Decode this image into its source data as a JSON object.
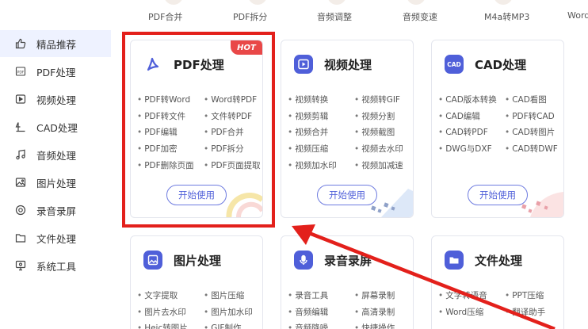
{
  "top_tools": [
    "PDF合并",
    "PDF拆分",
    "音频调整",
    "音频变速",
    "M4a转MP3",
    "Word"
  ],
  "sidebar": {
    "items": [
      {
        "label": "精品推荐",
        "icon": "thumbs-up-icon",
        "active": true
      },
      {
        "label": "PDF处理",
        "icon": "pdf-icon"
      },
      {
        "label": "视频处理",
        "icon": "video-play-icon"
      },
      {
        "label": "CAD处理",
        "icon": "cad-icon"
      },
      {
        "label": "音频处理",
        "icon": "music-note-icon"
      },
      {
        "label": "图片处理",
        "icon": "image-icon"
      },
      {
        "label": "录音录屏",
        "icon": "record-icon"
      },
      {
        "label": "文件处理",
        "icon": "folder-icon"
      },
      {
        "label": "系统工具",
        "icon": "system-tool-icon"
      }
    ]
  },
  "cards": [
    {
      "title": "PDF处理",
      "badge": "HOT",
      "icon": "pdf-icon",
      "features": [
        "PDF转Word",
        "Word转PDF",
        "PDF转文件",
        "文件转PDF",
        "PDF编辑",
        "PDF合并",
        "PDF加密",
        "PDF拆分",
        "PDF删除页面",
        "PDF页面提取"
      ],
      "button": "开始使用"
    },
    {
      "title": "视频处理",
      "icon": "video-play-icon",
      "features": [
        "视频转换",
        "视频转GIF",
        "视频剪辑",
        "视频分割",
        "视频合并",
        "视频截图",
        "视频压缩",
        "视频去水印",
        "视频加水印",
        "视频加减速"
      ],
      "button": "开始使用"
    },
    {
      "title": "CAD处理",
      "icon": "cad-icon",
      "features": [
        "CAD版本转换",
        "CAD看图",
        "CAD编辑",
        "PDF转CAD",
        "CAD转PDF",
        "CAD转图片",
        "DWG与DXF",
        "CAD转DWF"
      ],
      "button": "开始使用"
    },
    {
      "title": "图片处理",
      "icon": "image-icon",
      "features": [
        "文字提取",
        "图片压缩",
        "图片去水印",
        "图片加水印",
        "Heic转图片",
        "GIF制作"
      ]
    },
    {
      "title": "录音录屏",
      "icon": "microphone-icon",
      "features": [
        "录音工具",
        "屏幕录制",
        "音频编辑",
        "高清录制",
        "音频降噪",
        "快捷操作"
      ]
    },
    {
      "title": "文件处理",
      "icon": "folder-icon",
      "features": [
        "文字转语音",
        "PPT压缩",
        "Word压缩",
        "翻译助手"
      ]
    }
  ],
  "colors": {
    "accent": "#4f5fd9",
    "highlight": "#e3201b",
    "hot": "#e94848",
    "sidebar_active": "#eef2ff"
  }
}
